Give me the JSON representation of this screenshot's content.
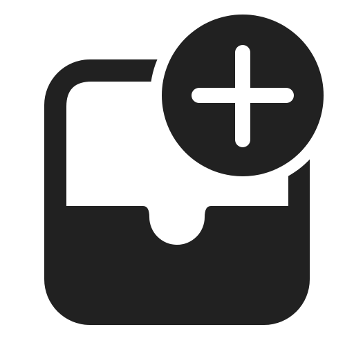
{
  "icon": {
    "name": "mail-inbox-add-icon",
    "color": "#212121"
  }
}
